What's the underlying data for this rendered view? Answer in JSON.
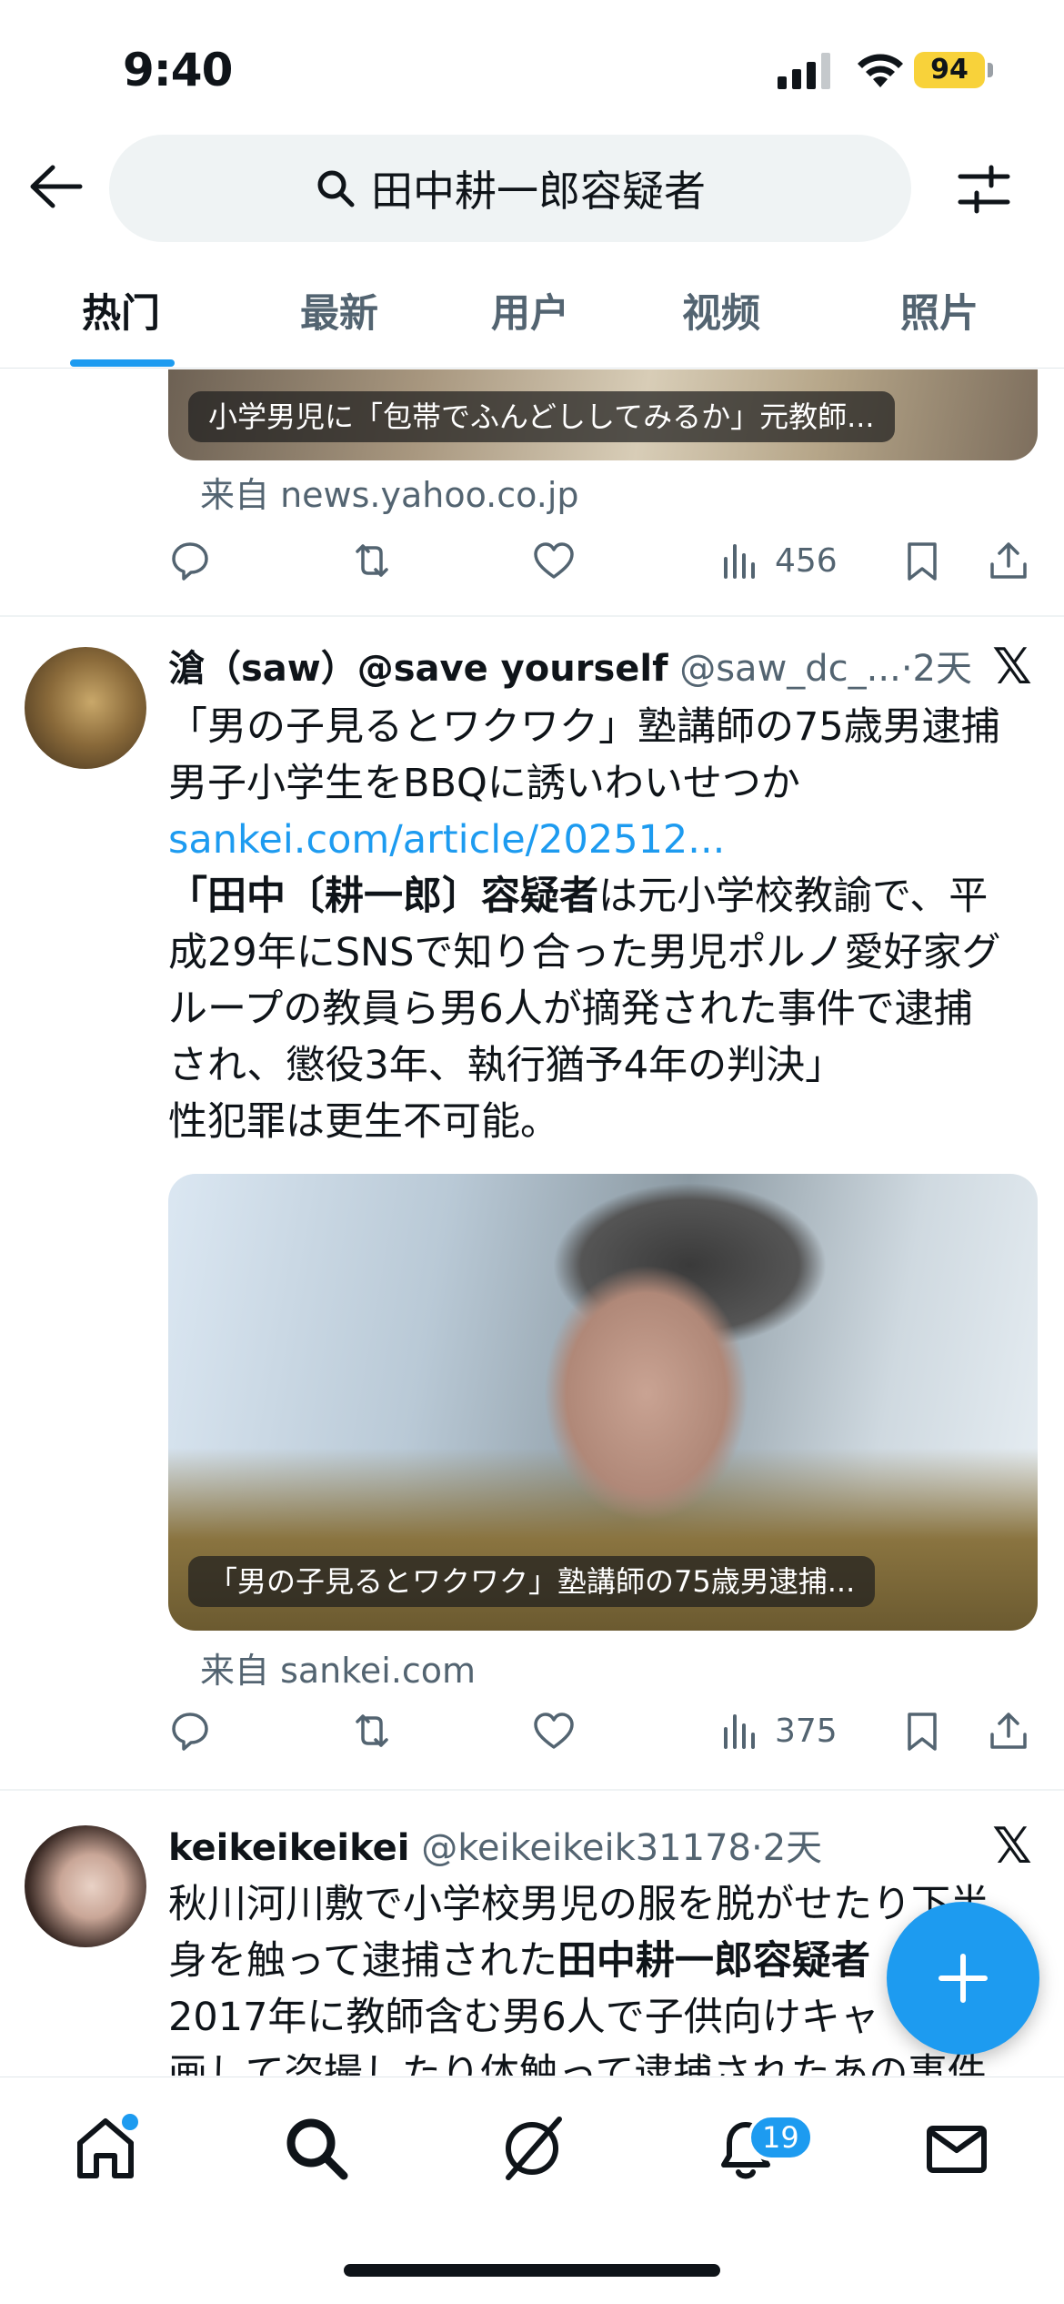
{
  "status": {
    "time": "9:40",
    "battery": "94"
  },
  "search": {
    "query": "田中耕一郎容疑者"
  },
  "tabs": [
    {
      "label": "热门",
      "active": true
    },
    {
      "label": "最新"
    },
    {
      "label": "用户"
    },
    {
      "label": "视频"
    },
    {
      "label": "照片"
    }
  ],
  "post1": {
    "image_caption": "小学男児に「包帯でふんどししてみるか」元教師...",
    "source": "来自 news.yahoo.co.jp",
    "views": "456"
  },
  "post2": {
    "name": "滄（saw）@save yourself",
    "handle": "@saw_dc_...",
    "dot": "·",
    "time": "2天",
    "line1": "「男の子見るとワクワク」塾講師の75歳男逮捕",
    "line2": "男子小学生をBBQに誘いわいせつか",
    "link": "sankei.com/article/202512...",
    "quote_bold": "「田中〔耕一郎〕容疑者",
    "quote_rest1": "は元小学校教諭で、平",
    "quote_line2": "成29年にSNSで知り合った男児ポルノ愛好家グ",
    "quote_line3": "ループの教員ら男6人が摘発された事件で逮捕",
    "quote_line4": "され、懲役3年、執行猶予4年の判決」",
    "line_end": "性犯罪は更生不可能。",
    "image_caption": "「男の子見るとワクワク」塾講師の75歳男逮捕...",
    "source": "来自 sankei.com",
    "views": "375"
  },
  "post3": {
    "name": "keikeikeikei",
    "handle": "@keikeikeik31178",
    "dot": "·",
    "time": "2天",
    "line1": "秋川河川敷で小学校男児の服を脱がせたり下半",
    "line2_a": "身を触って逮捕された",
    "line2_bold": "田中耕一郎容疑者",
    "line3": "2017年に教師含む男6人で子供向けキャ",
    "line4": "画して盗撮したり体触って逮捕されたあの事件"
  },
  "notifications_badge": "19",
  "colors": {
    "accent": "#1d9bf0",
    "text": "#0f1419",
    "muted": "#536471"
  }
}
